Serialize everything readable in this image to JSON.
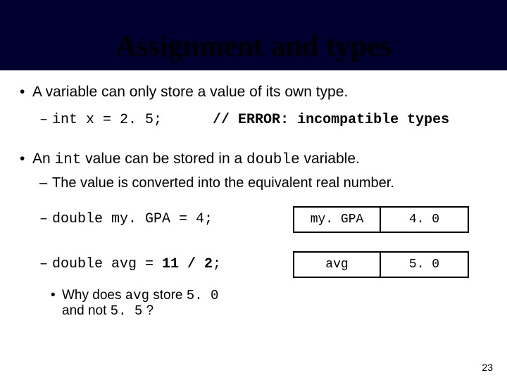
{
  "title": "Assignment and types",
  "bullets": {
    "b1": "A variable can only store a value of its own type.",
    "code1_left": "int x = 2. 5;",
    "code1_right": "// ERROR: incompatible types",
    "b2_pre": "An ",
    "b2_mid1": "int",
    "b2_mid2": " value can be stored in a ",
    "b2_mid3": "double",
    "b2_post": " variable.",
    "b2_sub": "The value is converted into the equivalent real number.",
    "code2": "double my. GPA = 4;",
    "box1_left": "my. GPA",
    "box1_right": "4. 0",
    "code3": "double avg = ",
    "code3_bold": "11 / 2",
    "code3_end": ";",
    "box2_left": "avg",
    "box2_right": "5. 0",
    "why_pre": "Why does ",
    "why_m1": "avg",
    "why_m2": " store ",
    "why_m3": "5. 0",
    "why_m4": " and not ",
    "why_m5": "5. 5",
    "why_end": " ?"
  },
  "page_number": "23"
}
